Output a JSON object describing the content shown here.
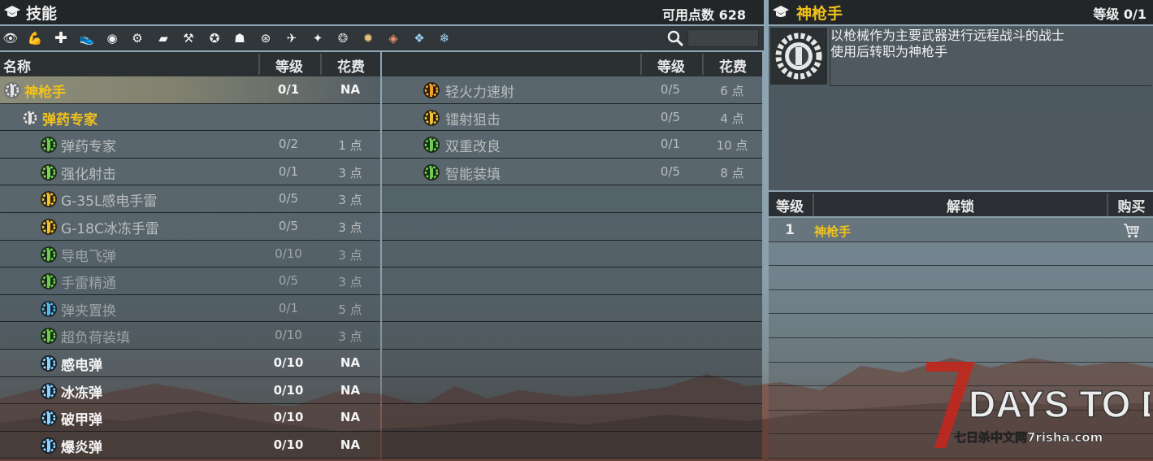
{
  "left": {
    "title": "技能",
    "points": "可用点数 628",
    "columns": {
      "name": "名称",
      "level": "等级",
      "cost": "花费"
    },
    "list1": [
      {
        "name": "神枪手",
        "level": "0/1",
        "cost": "NA",
        "style": "sel",
        "color": "yellow",
        "icon": "gear-skull-icon"
      },
      {
        "name": "弹药专家",
        "level": "",
        "cost": "",
        "style": "",
        "color": "yellow",
        "icon": "gear-bullet-icon"
      },
      {
        "name": "弹药专家",
        "level": "0/2",
        "cost": "1 点",
        "style": "",
        "color": "dim",
        "icon": "bullet-icon"
      },
      {
        "name": "强化射击",
        "level": "0/1",
        "cost": "3 点",
        "style": "",
        "color": "dim",
        "icon": "crosshair-icon"
      },
      {
        "name": "G-35L感电手雷",
        "level": "0/5",
        "cost": "3 点",
        "style": "",
        "color": "dim",
        "icon": "grenade-icon"
      },
      {
        "name": "G-18C冰冻手雷",
        "level": "0/5",
        "cost": "3 点",
        "style": "",
        "color": "dim",
        "icon": "grenade-icon"
      },
      {
        "name": "导电飞弹",
        "level": "0/10",
        "cost": "3 点",
        "style": "dark",
        "color": "dimmer",
        "icon": "missile-icon"
      },
      {
        "name": "手雷精通",
        "level": "0/5",
        "cost": "3 点",
        "style": "dark",
        "color": "dimmer",
        "icon": "grenade-mastery-icon"
      },
      {
        "name": "弹夹置换",
        "level": "0/1",
        "cost": "5 点",
        "style": "dark",
        "color": "dimmer",
        "icon": "magazine-icon"
      },
      {
        "name": "超负荷装填",
        "level": "0/10",
        "cost": "3 点",
        "style": "dark",
        "color": "dimmer",
        "icon": "overload-icon"
      },
      {
        "name": "感电弹",
        "level": "0/10",
        "cost": "NA",
        "style": "bold",
        "color": "white",
        "icon": "shock-round-icon"
      },
      {
        "name": "冰冻弹",
        "level": "0/10",
        "cost": "NA",
        "style": "bold",
        "color": "white",
        "icon": "frost-round-icon"
      },
      {
        "name": "破甲弹",
        "level": "0/10",
        "cost": "NA",
        "style": "bold",
        "color": "white",
        "icon": "ap-round-icon"
      },
      {
        "name": "爆炎弹",
        "level": "0/10",
        "cost": "NA",
        "style": "bold",
        "color": "white",
        "icon": "fire-round-icon"
      }
    ],
    "list2": [
      {
        "name": "轻火力速射",
        "level": "0/5",
        "cost": "6 点",
        "icon": "rapid-fire-icon"
      },
      {
        "name": "镭射狙击",
        "level": "0/5",
        "cost": "4 点",
        "icon": "laser-sniper-icon"
      },
      {
        "name": "双重改良",
        "level": "0/1",
        "cost": "10 点",
        "icon": "double-mod-icon"
      },
      {
        "name": "智能装填",
        "level": "0/5",
        "cost": "8 点",
        "icon": "smart-reload-icon"
      }
    ]
  },
  "right": {
    "title": "神枪手",
    "level": "等级 0/1",
    "description_line1": "以枪械作为主要武器进行远程战斗的战士",
    "description_line2": "使用后转职为神枪手",
    "unlock_columns": {
      "level": "等级",
      "unlock": "解锁",
      "buy": "购买"
    },
    "unlock_rows": [
      {
        "level": "1",
        "name": "神枪手"
      }
    ]
  },
  "watermark": {
    "brand": "DAYS TO DIE",
    "numeral": "7",
    "site": "七日杀中文网7risha.com"
  },
  "colors": {
    "accent_yellow": "#f2c21b",
    "panel_dark": "#1e2022",
    "logo_red": "#c0281e"
  }
}
